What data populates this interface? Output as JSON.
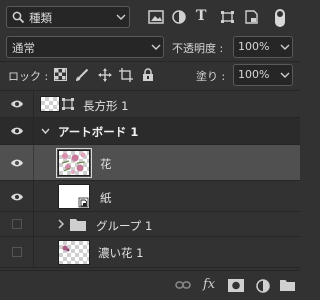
{
  "filter": {
    "kind_label": "種類",
    "type_glyph": "T"
  },
  "blend": {
    "mode": "通常",
    "opacity_label": "不透明度 :",
    "opacity_value": "100%"
  },
  "lock": {
    "label": "ロック :",
    "fill_label": "塗り :",
    "fill_value": "100%"
  },
  "layers": [
    {
      "name": "長方形 1",
      "visible": true,
      "type": "shape"
    },
    {
      "name": "アートボード 1",
      "visible": true,
      "type": "artboard"
    },
    {
      "name": "花",
      "visible": true,
      "type": "image",
      "selected": true
    },
    {
      "name": "紙",
      "visible": true,
      "type": "image"
    },
    {
      "name": "グループ 1",
      "visible": false,
      "type": "group"
    },
    {
      "name": "濃い花 1",
      "visible": false,
      "type": "image"
    }
  ],
  "bottom_bar": {
    "fx_label": "fx"
  },
  "colors": {
    "panel_bg": "#323232",
    "selected_row": "#505050",
    "field_bg": "#262626"
  }
}
